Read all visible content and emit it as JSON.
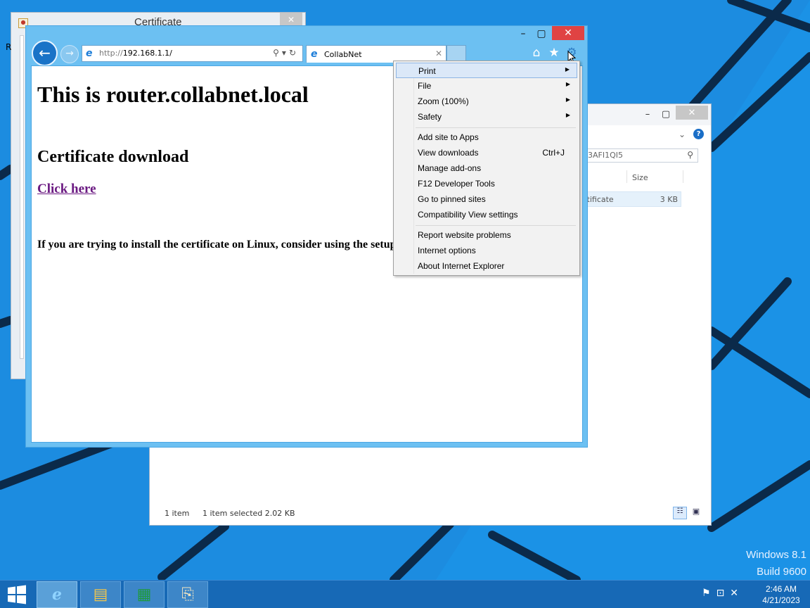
{
  "desktop": {
    "watermark_line1": "Windows 8.1",
    "watermark_line2": "Build 9600"
  },
  "cert_window": {
    "title": "Certificate",
    "close": "✕",
    "side_letter": "R"
  },
  "explorer_window": {
    "min": "–",
    "max": "▢",
    "close": "✕",
    "help": "?",
    "search_partial": "3AFI1QI5",
    "col_size": "Size",
    "row_name_partial": "rtificate",
    "row_size": "3 KB",
    "status_count": "1 item",
    "status_selected": "1 item selected  2.02 KB"
  },
  "ie_window": {
    "min": "–",
    "max": "▢",
    "close": "✕",
    "address": {
      "protocol": "http://",
      "host": "192.168.1.1/"
    },
    "tab_label": "CollabNet",
    "tab_close": "✕"
  },
  "page": {
    "heading": "This is router.collabnet.local",
    "subheading": "Certificate download",
    "link": "Click here",
    "note": "If you are trying to install the certificate on Linux, consider using the setup"
  },
  "menu": {
    "items": [
      {
        "label": "Print",
        "arrow": "▶"
      },
      {
        "label": "File",
        "arrow": "▶"
      },
      {
        "label": "Zoom (100%)",
        "arrow": "▶"
      },
      {
        "label": "Safety",
        "arrow": "▶"
      },
      {
        "label": "Add site to Apps"
      },
      {
        "label": "View downloads",
        "shortcut": "Ctrl+J"
      },
      {
        "label": "Manage add-ons"
      },
      {
        "label": "F12 Developer Tools"
      },
      {
        "label": "Go to pinned sites"
      },
      {
        "label": "Compatibility View settings"
      },
      {
        "label": "Report website problems"
      },
      {
        "label": "Internet options"
      },
      {
        "label": "About Internet Explorer"
      }
    ]
  },
  "taskbar": {
    "time": "2:46 AM",
    "date": "4/21/2023"
  },
  "colors": {
    "desktop_bg": "#1e8fe0",
    "ie_frame": "#6cc0f2",
    "close_red": "#e04343",
    "taskbar": "#1769b6",
    "link_visited": "#6b1a82"
  }
}
